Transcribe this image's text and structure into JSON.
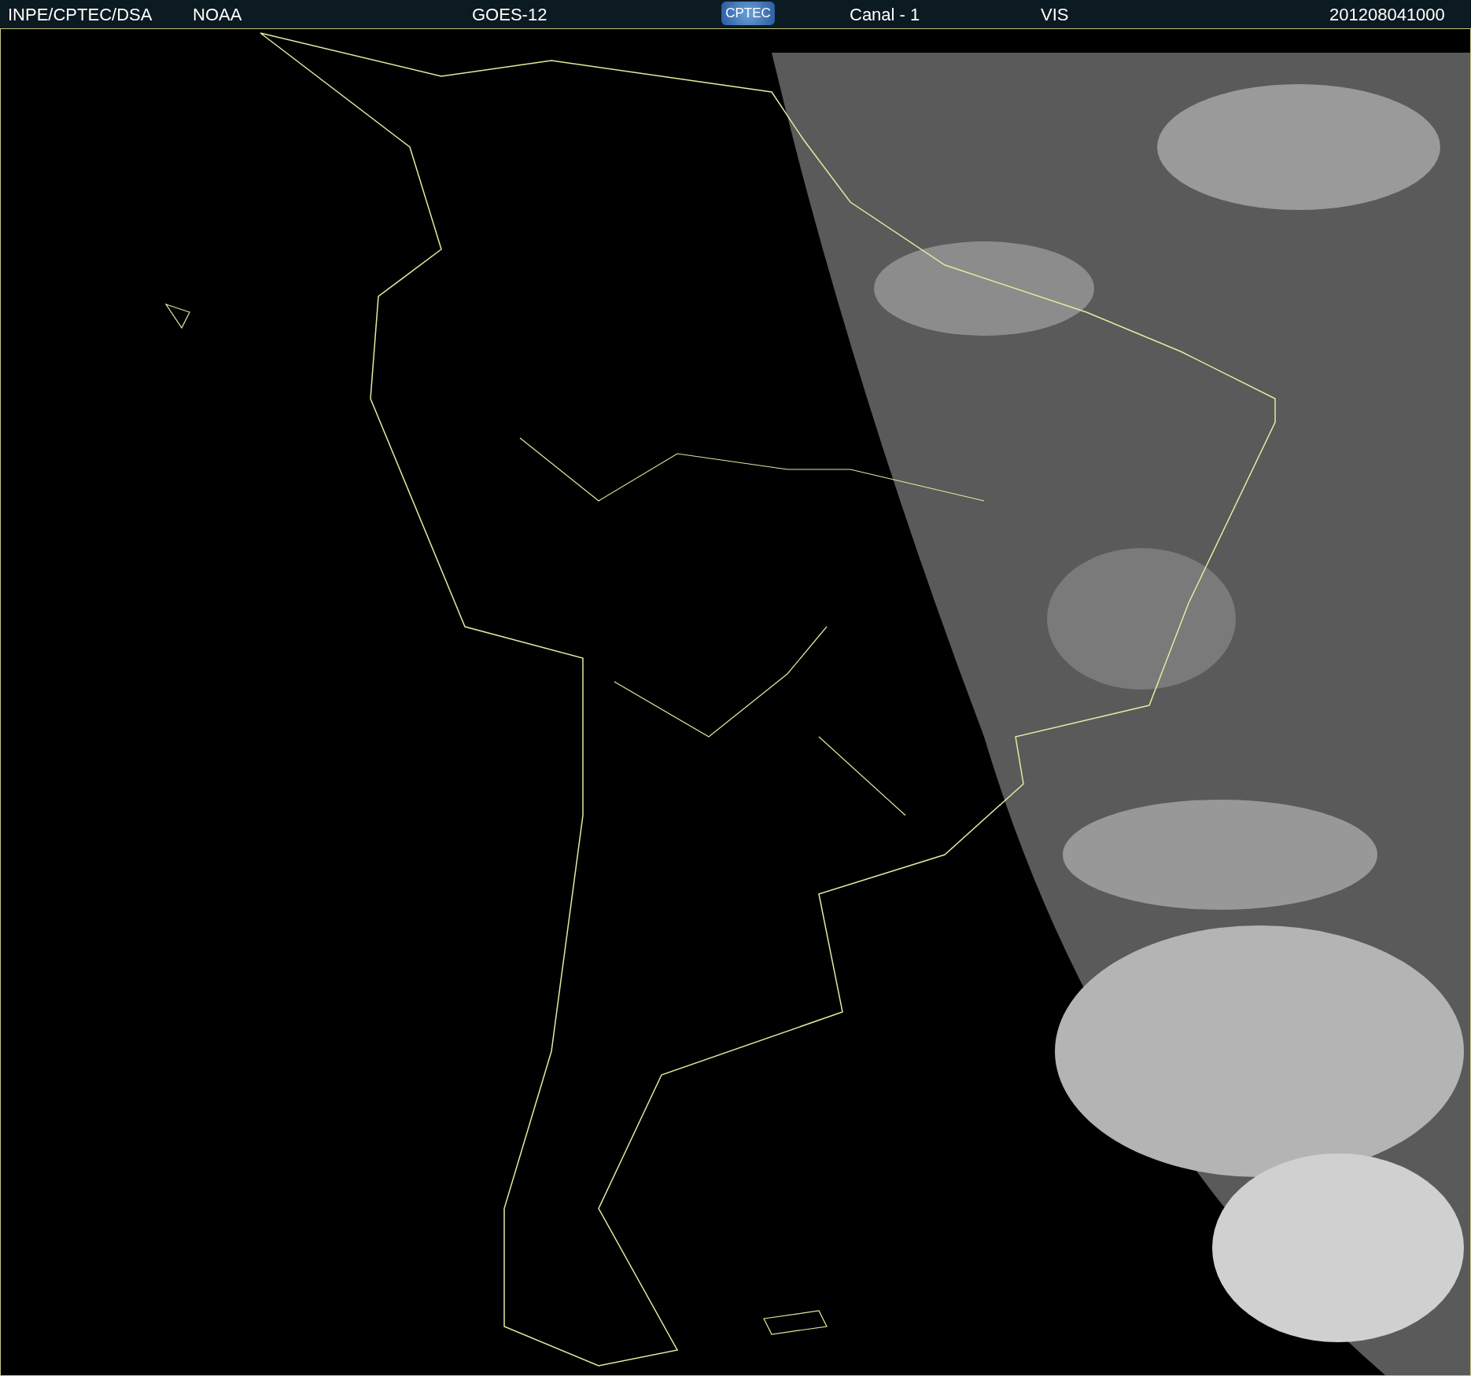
{
  "header": {
    "items": [
      {
        "kind": "text",
        "label": "INPE/CPTEC/DSA"
      },
      {
        "kind": "text",
        "label": "NOAA"
      },
      {
        "kind": "text",
        "label": "GOES-12"
      },
      {
        "kind": "logo",
        "label": "CPTEC"
      },
      {
        "kind": "text",
        "label": "Canal - 1"
      },
      {
        "kind": "text",
        "label": "VIS"
      },
      {
        "kind": "text",
        "label": "201208041000"
      }
    ]
  }
}
